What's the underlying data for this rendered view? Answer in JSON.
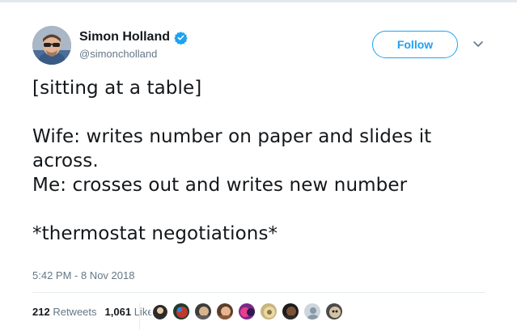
{
  "user": {
    "display_name": "Simon Holland",
    "handle": "@simoncholland",
    "verified": true
  },
  "actions": {
    "follow_label": "Follow"
  },
  "tweet": {
    "paragraphs": [
      "[sitting at a table]",
      "Wife: writes number on paper and slides it across.",
      "Me: crosses out and writes new number",
      "*thermostat negotiations*"
    ],
    "timestamp": "5:42 PM - 8 Nov 2018"
  },
  "stats": {
    "retweets_count": "212",
    "retweets_label": "Retweets",
    "likes_count": "1,061",
    "likes_label": "Likes"
  },
  "colors": {
    "accent": "#1da1f2",
    "text": "#14171a",
    "muted": "#657786"
  },
  "likers": [
    "liker-avatar-1",
    "liker-avatar-2",
    "liker-avatar-3",
    "liker-avatar-4",
    "liker-avatar-5",
    "liker-avatar-6",
    "liker-avatar-7",
    "liker-avatar-8",
    "liker-avatar-9",
    "liker-avatar-10"
  ]
}
